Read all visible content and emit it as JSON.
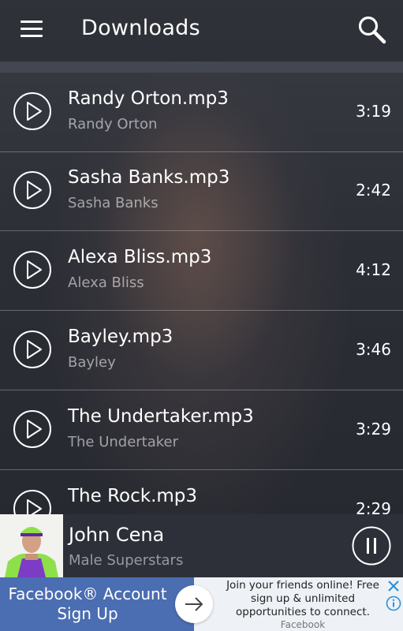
{
  "header": {
    "title": "Downloads",
    "menu_icon": "hamburger-menu-icon",
    "search_icon": "search-icon"
  },
  "tracks": [
    {
      "name": "Randy Orton.mp3",
      "artist": "Randy Orton",
      "duration": "3:19"
    },
    {
      "name": "Sasha Banks.mp3",
      "artist": "Sasha Banks",
      "duration": "2:42"
    },
    {
      "name": "Alexa Bliss.mp3",
      "artist": "Alexa Bliss",
      "duration": "4:12"
    },
    {
      "name": "Bayley.mp3",
      "artist": "Bayley",
      "duration": "3:46"
    },
    {
      "name": "The Undertaker.mp3",
      "artist": "The Undertaker",
      "duration": "3:29"
    },
    {
      "name": "The Rock.mp3",
      "artist": "",
      "duration": "2:29"
    }
  ],
  "now_playing": {
    "title": "John Cena",
    "category": "Male Superstars",
    "control_icon": "pause-icon"
  },
  "ad": {
    "headline_line1": "Facebook® Account",
    "headline_line2": "Sign Up",
    "body": "Join your friends online! Free sign up & unlimited opportunities to connect.",
    "brand": "Facebook",
    "accent_color": "#4b6db1"
  },
  "colors": {
    "background": "#2a2c33",
    "text_primary": "#ffffff",
    "text_secondary": "#9a9ca2"
  }
}
